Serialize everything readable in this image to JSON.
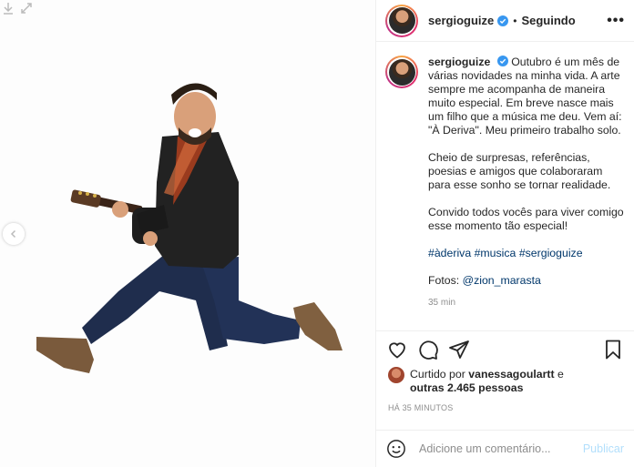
{
  "post": {
    "username": "sergioguize",
    "follow_state": "Seguindo",
    "separator": "•",
    "more": "•••"
  },
  "caption": {
    "username": "sergioguize",
    "paragraph1": "Outubro é um mês de várias novidades na minha vida. A arte sempre me acompanha de maneira muito especial. Em breve nasce mais um filho que a música me deu. Vem aí: \"À Deriva\". Meu primeiro trabalho solo.",
    "paragraph2": "Cheio de surpresas, referências, poesias e amigos que colaboraram para esse sonho se tornar realidade.",
    "paragraph3": "Convido todos vocês para viver comigo esse momento tão especial!",
    "hashtags": [
      "#àderiva",
      "#musica",
      "#sergioguize"
    ],
    "photos_prefix": "Fotos:",
    "photos_mention": "@zion_marasta",
    "time": "35 min"
  },
  "likes": {
    "prefix": "Curtido por",
    "user": "vanessagoulartt",
    "joiner": "e",
    "others": "outras 2.465 pessoas"
  },
  "timestamp": "HÁ 35 MINUTOS",
  "comment_box": {
    "placeholder": "Adicione um comentário...",
    "publish": "Publicar"
  },
  "icons": {
    "heart": "heart-icon",
    "comment": "comment-icon",
    "share": "paper-plane-icon",
    "save": "bookmark-icon",
    "emoji": "emoji-icon",
    "verified": "verified-badge-icon",
    "prev": "chevron-left-icon"
  },
  "colors": {
    "verified": "#3897f0",
    "link": "#00376b",
    "publish_disabled": "#b2dffc",
    "muted": "#8e8e8e"
  }
}
